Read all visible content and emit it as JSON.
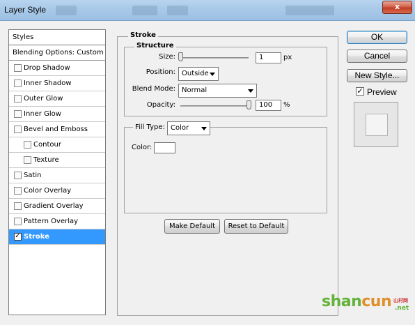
{
  "window": {
    "title": "Layer Style",
    "close_label": "x"
  },
  "styles_panel": {
    "header": "Styles",
    "blending_options": "Blending Options: Custom",
    "items": [
      {
        "label": "Drop Shadow",
        "checked": false,
        "indent": false,
        "selected": false
      },
      {
        "label": "Inner Shadow",
        "checked": false,
        "indent": false,
        "selected": false
      },
      {
        "label": "Outer Glow",
        "checked": false,
        "indent": false,
        "selected": false
      },
      {
        "label": "Inner Glow",
        "checked": false,
        "indent": false,
        "selected": false
      },
      {
        "label": "Bevel and Emboss",
        "checked": false,
        "indent": false,
        "selected": false
      },
      {
        "label": "Contour",
        "checked": false,
        "indent": true,
        "selected": false
      },
      {
        "label": "Texture",
        "checked": false,
        "indent": true,
        "selected": false
      },
      {
        "label": "Satin",
        "checked": false,
        "indent": false,
        "selected": false
      },
      {
        "label": "Color Overlay",
        "checked": false,
        "indent": false,
        "selected": false
      },
      {
        "label": "Gradient Overlay",
        "checked": false,
        "indent": false,
        "selected": false
      },
      {
        "label": "Pattern Overlay",
        "checked": false,
        "indent": false,
        "selected": false
      },
      {
        "label": "Stroke",
        "checked": true,
        "indent": false,
        "selected": true
      }
    ]
  },
  "stroke": {
    "section_title": "Stroke",
    "structure": {
      "title": "Structure",
      "size_label": "Size:",
      "size_value": "1",
      "size_unit": "px",
      "size_fraction": 0.0,
      "position_label": "Position:",
      "position_value": "Outside",
      "blend_label": "Blend Mode:",
      "blend_value": "Normal",
      "opacity_label": "Opacity:",
      "opacity_value": "100",
      "opacity_unit": "%",
      "opacity_fraction": 1.0
    },
    "fill": {
      "type_label": "Fill Type:",
      "type_value": "Color",
      "color_label": "Color:",
      "color_value": "#ffffff"
    },
    "make_default": "Make Default",
    "reset_default": "Reset to Default"
  },
  "buttons": {
    "ok": "OK",
    "cancel": "Cancel",
    "new_style": "New Style...",
    "preview_label": "Preview",
    "preview_checked": true
  },
  "watermark": {
    "text_a": "shan",
    "text_b": "cun",
    "sub": "山村网",
    "net": ".net"
  },
  "colors": {
    "selection": "#3399ff",
    "titlebar": "#a9c9e8",
    "close": "#c23f26"
  }
}
